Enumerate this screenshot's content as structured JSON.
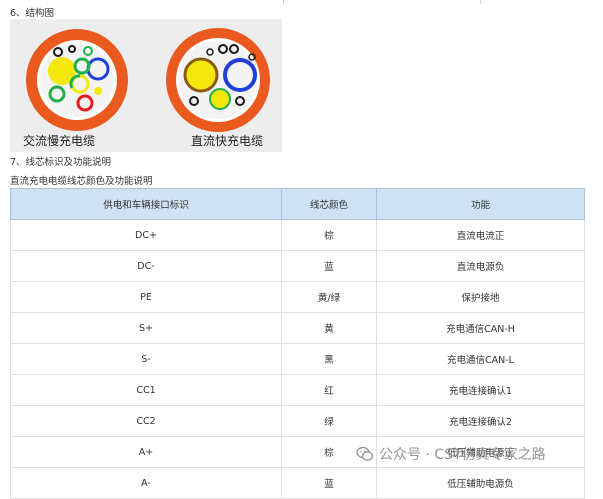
{
  "section6": {
    "title": "6、结构图"
  },
  "figure": {
    "caption_left": "交流慢充电缆",
    "caption_right": "直流快充电缆",
    "colors": {
      "sheath": "#ea5a1f",
      "inner": "#f2f2f2",
      "yellow": "#f2e80c",
      "green": "#20b04b",
      "blue": "#1f3fd8",
      "red": "#e51b1b",
      "black": "#1a1a1a"
    }
  },
  "section7": {
    "title": "7、线芯标识及功能说明",
    "subtitle": "直流充电电缆线芯颜色及功能说明"
  },
  "table": {
    "headers": [
      "供电和车辆接口标识",
      "线芯颜色",
      "功能"
    ],
    "rows": [
      [
        "DC+",
        "棕",
        "直流电流正"
      ],
      [
        "DC-",
        "蓝",
        "直流电源负"
      ],
      [
        "PE",
        "黄/绿",
        "保护接地"
      ],
      [
        "S+",
        "黄",
        "充电通信CAN-H"
      ],
      [
        "S-",
        "黑",
        "充电通信CAN-L"
      ],
      [
        "CC1",
        "红",
        "充电连接确认1"
      ],
      [
        "CC2",
        "绿",
        "充电连接确认2"
      ],
      [
        "A+",
        "棕",
        "低压辅助电源正"
      ],
      [
        "A-",
        "蓝",
        "低压辅助电源负"
      ]
    ]
  },
  "watermark": {
    "text": "公众号 · CST仿真专家之路",
    "icon": "wechat-icon"
  }
}
